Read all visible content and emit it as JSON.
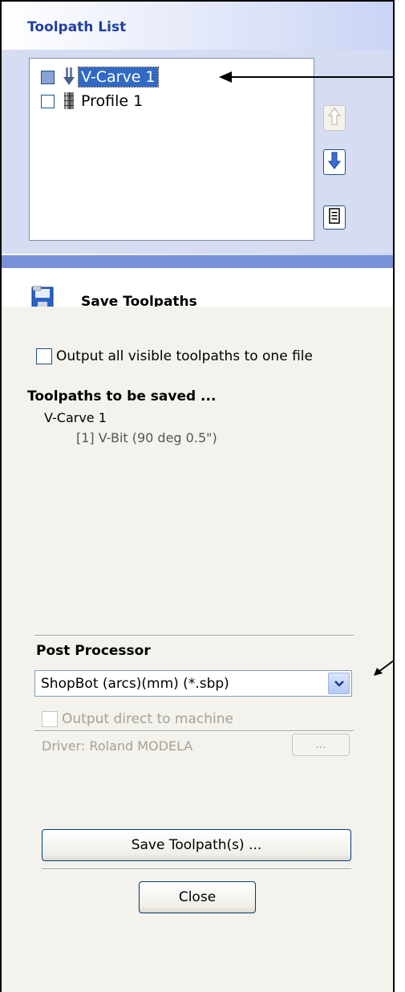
{
  "toolpath_list": {
    "title": "Toolpath List",
    "items": [
      {
        "label": "V-Carve 1",
        "checked": true,
        "selected": true,
        "icon": "v-carve-icon"
      },
      {
        "label": "Profile 1",
        "checked": false,
        "selected": false,
        "icon": "profile-icon"
      }
    ],
    "buttons": {
      "move_up": "arrow-up-icon",
      "move_down": "arrow-down-icon",
      "summary": "document-icon"
    }
  },
  "save_toolpaths": {
    "title": "Save Toolpaths",
    "icon": "floppy-disk-icon",
    "output_all_label": "Output all visible toolpaths to one file",
    "output_all_checked": false,
    "to_be_saved_heading": "Toolpaths to be saved ...",
    "saved_items": [
      {
        "name": "V-Carve 1",
        "tool": "[1] V-Bit (90 deg 0.5\")"
      }
    ]
  },
  "post_processor": {
    "heading": "Post Processor",
    "selected": "ShopBot (arcs)(mm) (*.sbp)",
    "output_direct_label": "Output direct to machine",
    "output_direct_checked": false,
    "driver_label": "Driver: Roland MODELA",
    "driver_button": "...",
    "save_button": "Save Toolpath(s) ...",
    "close_button": "Close"
  },
  "colors": {
    "accent": "#316ac5",
    "title_blue": "#2340a0",
    "separator_blue": "#7891d8"
  }
}
